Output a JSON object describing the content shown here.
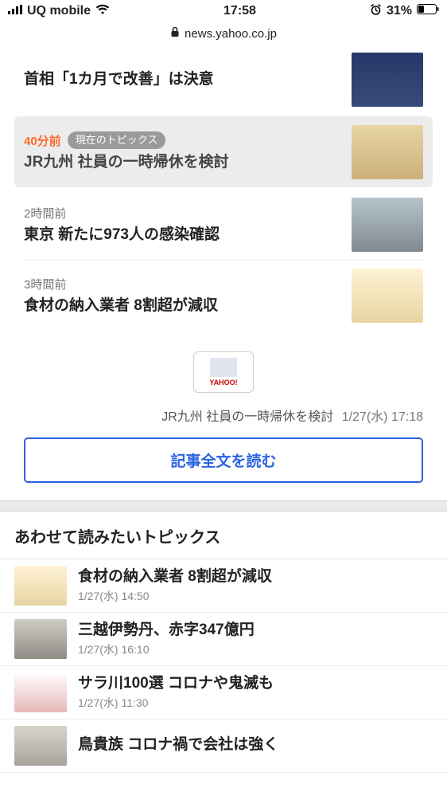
{
  "status": {
    "carrier": "UQ mobile",
    "time": "17:58",
    "battery": "31%"
  },
  "urlbar": {
    "domain": "news.yahoo.co.jp"
  },
  "topics": [
    {
      "time": "",
      "badge": "",
      "title": "首相「1カ月で改善」は決意",
      "accent": false
    },
    {
      "time": "40分前",
      "badge": "現在のトピックス",
      "title": "JR九州 社員の一時帰休を検討",
      "accent": true
    },
    {
      "time": "2時間前",
      "badge": "",
      "title": "東京 新たに973人の感染確認",
      "accent": false
    },
    {
      "time": "3時間前",
      "badge": "",
      "title": "食材の納入業者 8割超が減収",
      "accent": false
    }
  ],
  "yahoo_logo": "YAHOO!",
  "caption": {
    "title": "JR九州 社員の一時帰休を検討",
    "stamp": "1/27(水) 17:18"
  },
  "read_full": "記事全文を読む",
  "related_heading": "あわせて読みたいトピックス",
  "related": [
    {
      "title": "食材の納入業者 8割超が減収",
      "time": "1/27(水) 14:50"
    },
    {
      "title": "三越伊勢丹、赤字347億円",
      "time": "1/27(水) 16:10"
    },
    {
      "title": "サラ川100選 コロナや鬼滅も",
      "time": "1/27(水) 11:30"
    },
    {
      "title": "鳥貴族 コロナ禍で会社は強く",
      "time": ""
    }
  ]
}
